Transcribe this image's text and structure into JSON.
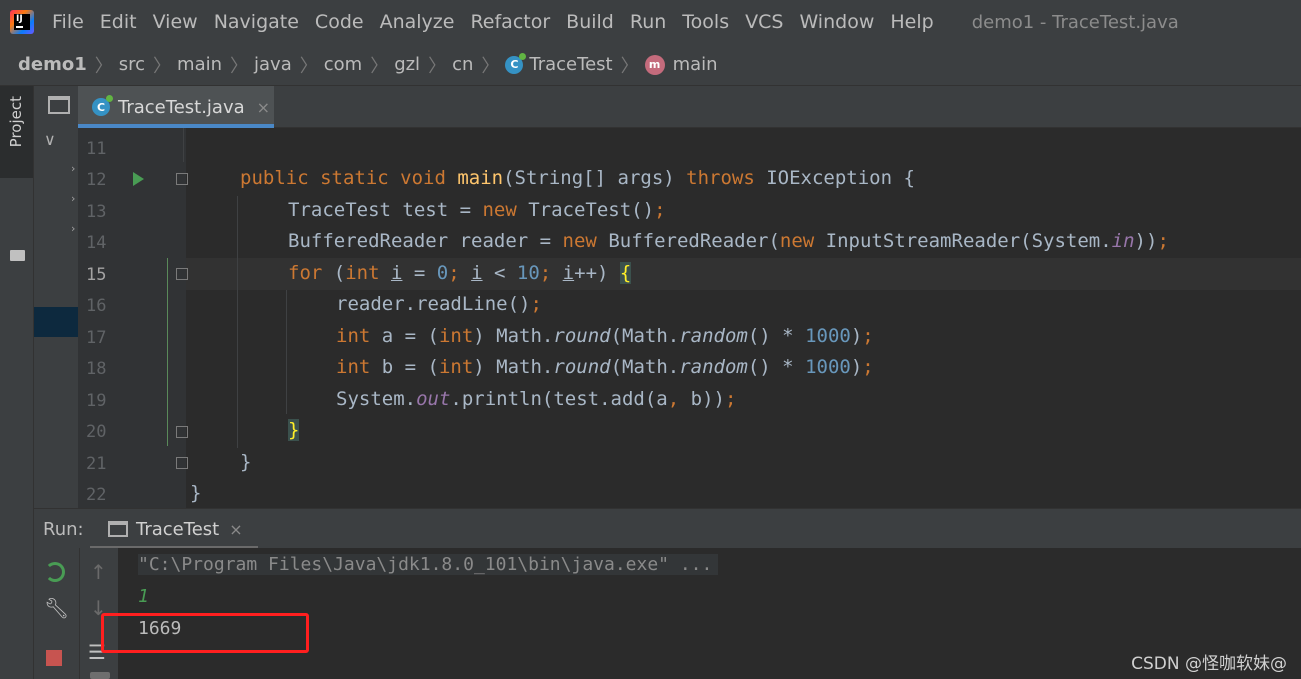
{
  "menu": {
    "items": [
      "File",
      "Edit",
      "View",
      "Navigate",
      "Code",
      "Analyze",
      "Refactor",
      "Build",
      "Run",
      "Tools",
      "VCS",
      "Window",
      "Help"
    ],
    "window_title": "demo1 - TraceTest.java"
  },
  "breadcrumb": [
    "demo1",
    "src",
    "main",
    "java",
    "com",
    "gzl",
    "cn",
    "TraceTest",
    "main"
  ],
  "left_strip": {
    "project_label": "Project"
  },
  "editor": {
    "tab_label": "TraceTest.java",
    "tab_close": "×",
    "lines": [
      "11",
      "12",
      "13",
      "14",
      "15",
      "16",
      "17",
      "18",
      "19",
      "20",
      "21",
      "22"
    ],
    "current_line": "15"
  },
  "run_panel": {
    "title": "Run:",
    "tab_label": "TraceTest",
    "tab_close": "×",
    "console": {
      "command": "\"C:\\Program Files\\Java\\jdk1.8.0_101\\bin\\java.exe\" ...",
      "input": "1",
      "output": "1669"
    }
  },
  "watermark": "CSDN @怪咖软妹@",
  "colors": {
    "keyword": "#cc7832",
    "method": "#ffc66d",
    "number": "#6897bb",
    "field": "#9876aa",
    "highlight_box": "#ff1f1f"
  }
}
